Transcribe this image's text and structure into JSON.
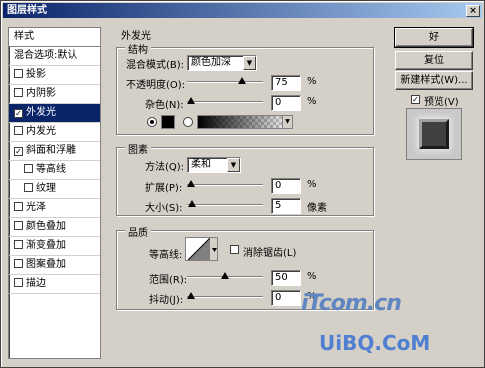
{
  "window": {
    "title": "图层样式",
    "close": "×"
  },
  "left_list": {
    "header": "样式",
    "items": [
      {
        "label": "混合选项:默认",
        "checkbox": false,
        "checked": false,
        "selected": false,
        "sub": false
      },
      {
        "label": "投影",
        "checkbox": true,
        "checked": false,
        "selected": false,
        "sub": false
      },
      {
        "label": "内阴影",
        "checkbox": true,
        "checked": false,
        "selected": false,
        "sub": false
      },
      {
        "label": "外发光",
        "checkbox": true,
        "checked": true,
        "selected": true,
        "sub": false
      },
      {
        "label": "内发光",
        "checkbox": true,
        "checked": false,
        "selected": false,
        "sub": false
      },
      {
        "label": "斜面和浮雕",
        "checkbox": true,
        "checked": true,
        "selected": false,
        "sub": false
      },
      {
        "label": "等高线",
        "checkbox": true,
        "checked": false,
        "selected": false,
        "sub": true
      },
      {
        "label": "纹理",
        "checkbox": true,
        "checked": false,
        "selected": false,
        "sub": true
      },
      {
        "label": "光泽",
        "checkbox": true,
        "checked": false,
        "selected": false,
        "sub": false
      },
      {
        "label": "颜色叠加",
        "checkbox": true,
        "checked": false,
        "selected": false,
        "sub": false
      },
      {
        "label": "渐变叠加",
        "checkbox": true,
        "checked": false,
        "selected": false,
        "sub": false
      },
      {
        "label": "图案叠加",
        "checkbox": true,
        "checked": false,
        "selected": false,
        "sub": false
      },
      {
        "label": "描边",
        "checkbox": true,
        "checked": false,
        "selected": false,
        "sub": false
      }
    ]
  },
  "outer_glow": {
    "title": "外发光",
    "structure": {
      "title": "结构",
      "blend_mode_label": "混合模式(B):",
      "blend_mode_value": "颜色加深",
      "opacity_label": "不透明度(O):",
      "opacity_value": "75",
      "opacity_unit": "%",
      "opacity_level": 0.75,
      "noise_label": "杂色(N):",
      "noise_value": "0",
      "noise_unit": "%",
      "noise_level": 0,
      "color_mode": "solid"
    },
    "elements": {
      "title": "图素",
      "technique_label": "方法(Q):",
      "technique_value": "柔和",
      "spread_label": "扩展(P):",
      "spread_value": "0",
      "spread_unit": "%",
      "spread_level": 0,
      "size_label": "大小(S):",
      "size_value": "5",
      "size_unit": "像素",
      "size_level": 0.02
    },
    "quality": {
      "title": "品质",
      "contour_label": "等高线:",
      "antialias_label": "消除锯齿(L)",
      "antialias_checked": false,
      "range_label": "范围(R):",
      "range_value": "50",
      "range_unit": "%",
      "range_level": 0.5,
      "jitter_label": "抖动(J):",
      "jitter_value": "0",
      "jitter_unit": "%",
      "jitter_level": 0
    }
  },
  "buttons": {
    "ok": "好",
    "reset": "复位",
    "new_style": "新建样式(W)...",
    "preview_label": "预览(V)",
    "preview_checked": true
  },
  "watermark": {
    "line1": "iTcom.cn",
    "line2": "UiBQ.CoM"
  },
  "colors": {
    "selection": "#0a246a",
    "dialog_bg": "#d4d0c8",
    "glow_color": "#000000"
  }
}
